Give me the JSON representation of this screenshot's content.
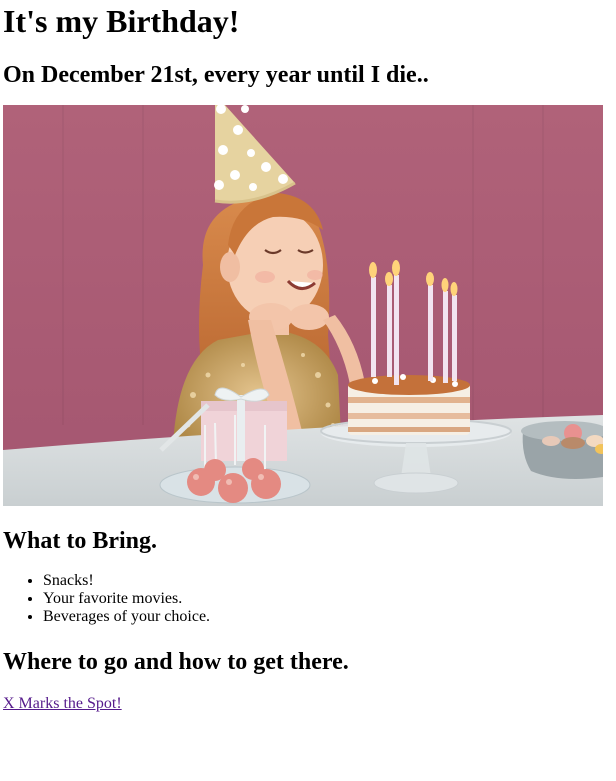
{
  "title": "It's my Birthday!",
  "subtitle": "On December 21st, every year until I die..",
  "image": {
    "alt": "",
    "colors": {
      "background": "#ad6078",
      "table": "#d9dedf"
    }
  },
  "bring": {
    "heading": "What to Bring.",
    "items": [
      "Snacks!",
      "Your favorite movies.",
      "Beverages of your choice."
    ]
  },
  "directions": {
    "heading": "Where to go and how to get there.",
    "link_label": "X Marks the Spot!",
    "link_color": "#551a8b"
  }
}
